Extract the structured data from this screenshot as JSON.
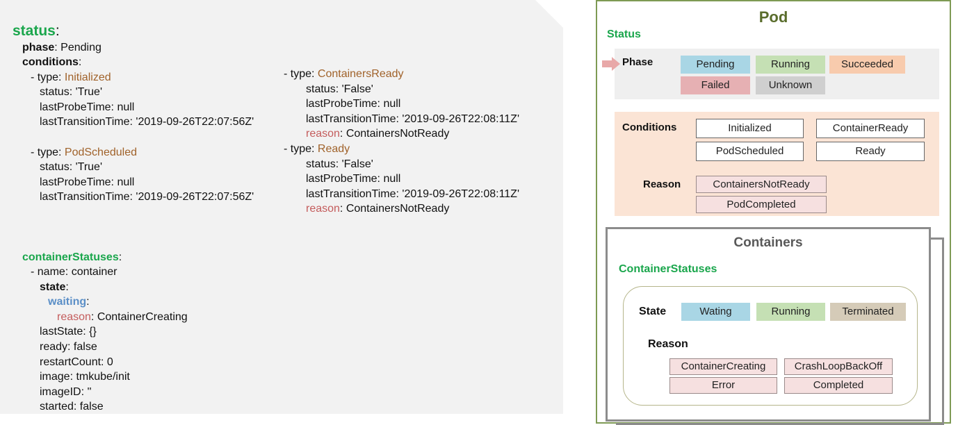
{
  "yaml": {
    "status_key": "status",
    "colon": ":",
    "phase_key": "phase",
    "phase_value": ": Pending",
    "conditions_key": "conditions",
    "conditions": [
      {
        "type_prefix": "- type: ",
        "type": "Initialized",
        "status": "status: 'True'",
        "probe": "lastProbeTime: null",
        "transition": "lastTransitionTime: '2019-09-26T22:07:56Z'"
      },
      {
        "type_prefix": "- type: ",
        "type": "PodScheduled",
        "status": "status: 'True'",
        "probe": "lastProbeTime: null",
        "transition": "lastTransitionTime: '2019-09-26T22:07:56Z'"
      },
      {
        "type_prefix": "- type: ",
        "type": "ContainersReady",
        "status": "status: 'False'",
        "probe": "lastProbeTime: null",
        "transition": "lastTransitionTime: '2019-09-26T22:08:11Z'",
        "reason_key": "reason",
        "reason_value": ": ContainersNotReady"
      },
      {
        "type_prefix": "- type: ",
        "type": "Ready",
        "status": "status: 'False'",
        "probe": "lastProbeTime: null",
        "transition": "lastTransitionTime: '2019-09-26T22:08:11Z'",
        "reason_key": "reason",
        "reason_value": ": ContainersNotReady"
      }
    ],
    "container_statuses_key": "containerStatuses",
    "name_line": "- name: container",
    "state_key": "state",
    "waiting_key": "waiting",
    "reason_key": "reason",
    "reason_value": ": ContainerCreating",
    "last_state": "lastState: {}",
    "ready": "ready: false",
    "restart_count": "restartCount: 0",
    "image": "image: tmkube/init",
    "image_id": "imageID: ''",
    "started": "started: false"
  },
  "diagram": {
    "pod_title": "Pod",
    "status_label": "Status",
    "phase_label": "Phase",
    "phases": [
      "Pending",
      "Running",
      "Succeeded",
      "Failed",
      "Unknown"
    ],
    "conditions_label": "Conditions",
    "conditions": [
      "Initialized",
      "ContainerReady",
      "PodScheduled",
      "Ready"
    ],
    "reason_label": "Reason",
    "reasons": [
      "ContainersNotReady",
      "PodCompleted"
    ],
    "containers_title": "Containers",
    "container_statuses_label": "ContainerStatuses",
    "state_label": "State",
    "states": [
      "Wating",
      "Running",
      "Terminated"
    ],
    "container_reason_label": "Reason",
    "container_reasons": [
      "ContainerCreating",
      "CrashLoopBackOff",
      "Error",
      "Completed"
    ]
  },
  "colors": {
    "green_key": "#1aa64c",
    "brown_value": "#a0622a",
    "red_key": "#c45c5c",
    "blue_key": "#5b8fc7",
    "pod_border": "#7e9a54",
    "phase_pending": "#a9d6e5",
    "phase_running": "#c5e0b4",
    "phase_succeeded": "#f8cbad",
    "phase_failed": "#e6b0b3",
    "phase_unknown": "#cfcfcf",
    "conditions_bg": "#fbe4d5",
    "state_terminated": "#d5cbb8"
  }
}
